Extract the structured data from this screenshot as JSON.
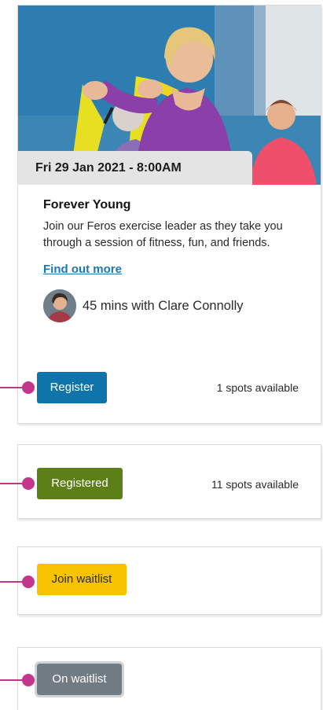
{
  "card": {
    "date": "Fri 29 Jan 2021 - 8:00AM",
    "title": "Forever Young",
    "description": "Join our Feros exercise leader as they take you through a session of fitness, fun, and friends.",
    "link": "Find out more",
    "leader": "45 mins with Clare Connolly",
    "button": "Register",
    "spots": "1 spots available"
  },
  "registered_card": {
    "button": "Registered",
    "spots": "11 spots available"
  },
  "waitlist_card": {
    "button": "Join waitlist"
  },
  "on_waitlist_card": {
    "button": "On waitlist"
  },
  "colors": {
    "register": "#0f74aa",
    "registered": "#5d7f17",
    "join_waitlist": "#f7c200",
    "on_waitlist": "#717b84",
    "pointer": "#c4368c",
    "link": "#1a78b0"
  }
}
